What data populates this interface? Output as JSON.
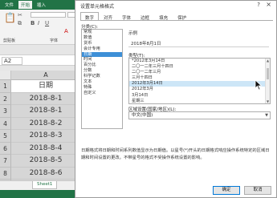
{
  "excel": {
    "ribbon_tabs": [
      "文件",
      "开始",
      "插入"
    ],
    "clipboard_label": "剪贴板",
    "font_label": "字体",
    "font_controls": [
      "B",
      "I",
      "U",
      "A"
    ],
    "name_box": "A2",
    "column_header": "A",
    "rows": [
      {
        "num": "1",
        "value": "日期"
      },
      {
        "num": "2",
        "value": "2018-8-1"
      },
      {
        "num": "3",
        "value": "2018-8-1"
      },
      {
        "num": "4",
        "value": "2018-8-2"
      },
      {
        "num": "5",
        "value": "2018-8-3"
      },
      {
        "num": "6",
        "value": "2018-8-4"
      },
      {
        "num": "7",
        "value": "2018-8-5"
      },
      {
        "num": "8",
        "value": "2018-8-6"
      },
      {
        "num": "9",
        "value": "2018-8-7"
      }
    ],
    "sheet_tab": "Sheet1"
  },
  "dialog": {
    "title": "设置单元格格式",
    "help": "?",
    "close": "×",
    "tabs": [
      "数字",
      "对齐",
      "字体",
      "边框",
      "填充",
      "保护"
    ],
    "category_label": "分类(C):",
    "categories": [
      "常规",
      "数值",
      "货币",
      "会计专用",
      "日期",
      "时间",
      "百分比",
      "分数",
      "科学记数",
      "文本",
      "特殊",
      "自定义"
    ],
    "selected_category_index": 4,
    "sample_label": "示例",
    "sample_value": "2018年8月1日",
    "type_label": "类型(T):",
    "types": [
      "*2012年3月14日",
      "二〇一二年三月十四日",
      "二〇一二年三月",
      "三月十四日",
      "2012年3月14日",
      "2012年3月",
      "3月14日",
      "星期三"
    ],
    "selected_type_index": 4,
    "locale_label": "区域设置(国家/地区)(L):",
    "locale_value": "中文(中国)",
    "description": "日期格式将日期和时间系列数值显示为日期值。以星号(*)开头的日期格式响应操作系统特定的区域日期和时间设置的更改。不带星号的格式不受操作系统设置的影响。",
    "ok": "确定",
    "cancel": "取消"
  },
  "colors": {
    "excel_green": "#217346",
    "selection_blue": "#3d8fd7",
    "type_highlight": "#cde6f7"
  }
}
